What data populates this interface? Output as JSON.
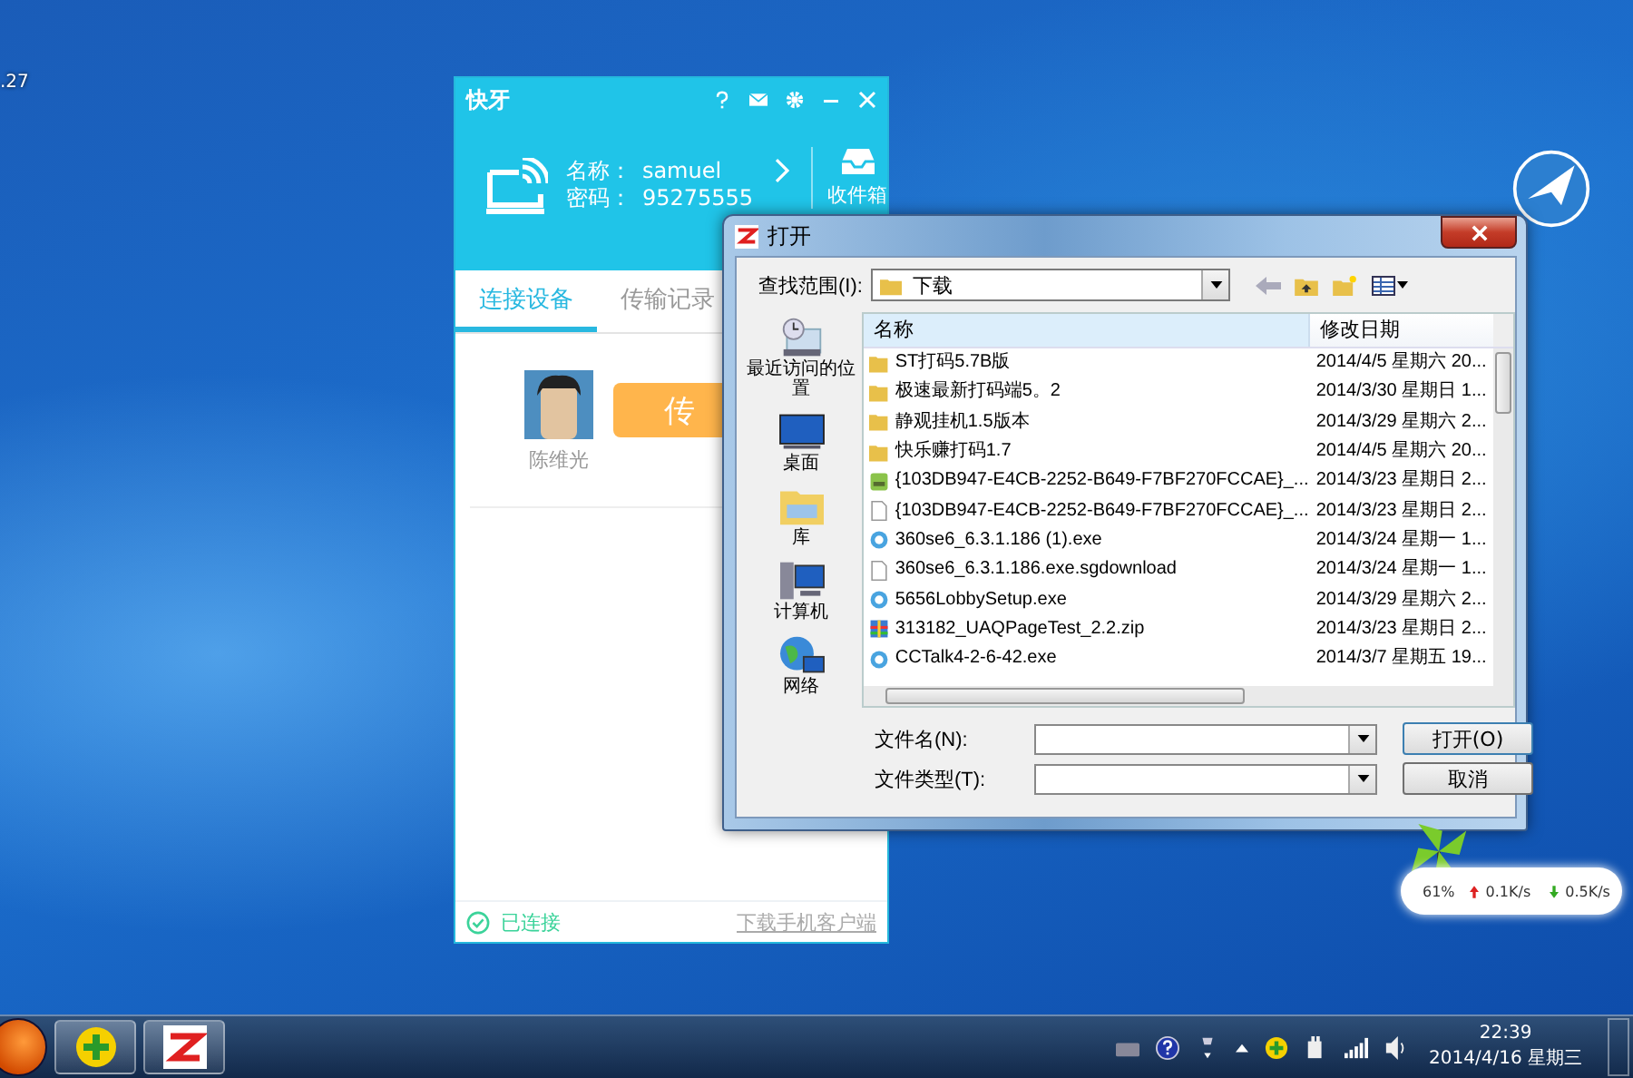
{
  "desktop": {
    "edge_label": ".27"
  },
  "app": {
    "title": "快牙",
    "name_label": "名称：",
    "name": "samuel",
    "code_label": "密码：",
    "code": "95275555",
    "inbox": "收件箱",
    "tabs": [
      {
        "label": "连接设备",
        "selected": true
      },
      {
        "label": "传输记录",
        "selected": false
      }
    ],
    "contact": {
      "name": "陈维光",
      "send_button": "传"
    },
    "status": {
      "label": "已连接",
      "connected": true
    },
    "download_link": "下载手机客户端"
  },
  "dialog": {
    "title": "打开",
    "look_in_label": "查找范围(I):",
    "look_in": "下载",
    "places": [
      {
        "label": "最近访问的位置",
        "kind": "recent"
      },
      {
        "label": "桌面",
        "kind": "desktop"
      },
      {
        "label": "库",
        "kind": "library"
      },
      {
        "label": "计算机",
        "kind": "computer"
      },
      {
        "label": "网络",
        "kind": "network"
      }
    ],
    "columns": [
      "名称",
      "修改日期"
    ],
    "files": [
      {
        "name": "ST打码5.7B版",
        "date": "2014/4/5 星期六 20...",
        "kind": "folder"
      },
      {
        "name": "极速最新打码端5。2",
        "date": "2014/3/30 星期日 1...",
        "kind": "folder"
      },
      {
        "name": "静观挂机1.5版本",
        "date": "2014/3/29 星期六 2...",
        "kind": "folder"
      },
      {
        "name": "快乐赚打码1.7",
        "date": "2014/4/5 星期六 20...",
        "kind": "folder"
      },
      {
        "name": "{103DB947-E4CB-2252-B649-F7BF270FCCAE}_...",
        "date": "2014/3/23 星期日 2...",
        "kind": "package"
      },
      {
        "name": "{103DB947-E4CB-2252-B649-F7BF270FCCAE}_...",
        "date": "2014/3/23 星期日 2...",
        "kind": "document"
      },
      {
        "name": "360se6_6.3.1.186 (1).exe",
        "date": "2014/3/24 星期一 1...",
        "kind": "app"
      },
      {
        "name": "360se6_6.3.1.186.exe.sgdownload",
        "date": "2014/3/24 星期一 1...",
        "kind": "document"
      },
      {
        "name": "5656LobbySetup.exe",
        "date": "2014/3/29 星期六 2...",
        "kind": "app"
      },
      {
        "name": "313182_UAQPageTest_2.2.zip",
        "date": "2014/3/23 星期日 2...",
        "kind": "archive"
      },
      {
        "name": "CCTalk4-2-6-42.exe",
        "date": "2014/3/7 星期五 19...",
        "kind": "app"
      }
    ],
    "file_name_label": "文件名(N):",
    "file_type_label": "文件类型(T):",
    "open_button": "打开(O)",
    "cancel_button": "取消"
  },
  "widget": {
    "percent": "61%",
    "upload": "0.1K/s",
    "download": "0.5K/s"
  },
  "taskbar": {
    "time": "22:39",
    "date": "2014/4/16 星期三"
  }
}
